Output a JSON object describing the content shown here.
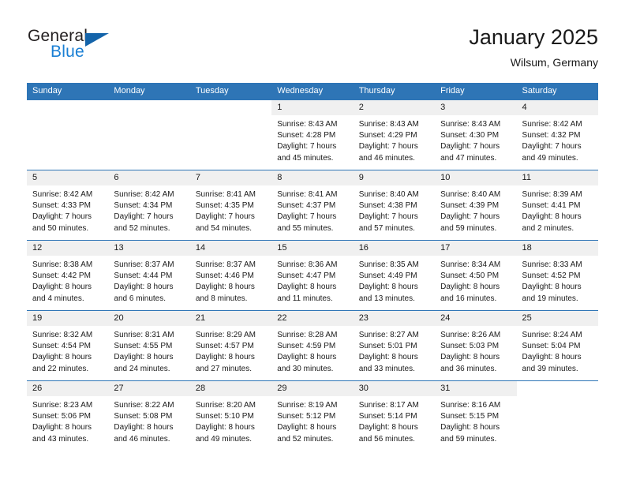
{
  "brand": {
    "name_part1": "General",
    "name_part2": "Blue",
    "triangle_color": "#1464aa",
    "blue_color": "#1a7fd4",
    "dark_color": "#231f20"
  },
  "header": {
    "title": "January 2025",
    "subtitle": "Wilsum, Germany"
  },
  "theme": {
    "header_bg": "#2e75b6",
    "daynum_bg": "#f0f0f0",
    "rule_color": "#2e75b6"
  },
  "weekday_headers": [
    "Sunday",
    "Monday",
    "Tuesday",
    "Wednesday",
    "Thursday",
    "Friday",
    "Saturday"
  ],
  "weeks": [
    [
      {
        "day": "",
        "lines": []
      },
      {
        "day": "",
        "lines": []
      },
      {
        "day": "",
        "lines": []
      },
      {
        "day": "1",
        "lines": [
          "Sunrise: 8:43 AM",
          "Sunset: 4:28 PM",
          "Daylight: 7 hours",
          "and 45 minutes."
        ]
      },
      {
        "day": "2",
        "lines": [
          "Sunrise: 8:43 AM",
          "Sunset: 4:29 PM",
          "Daylight: 7 hours",
          "and 46 minutes."
        ]
      },
      {
        "day": "3",
        "lines": [
          "Sunrise: 8:43 AM",
          "Sunset: 4:30 PM",
          "Daylight: 7 hours",
          "and 47 minutes."
        ]
      },
      {
        "day": "4",
        "lines": [
          "Sunrise: 8:42 AM",
          "Sunset: 4:32 PM",
          "Daylight: 7 hours",
          "and 49 minutes."
        ]
      }
    ],
    [
      {
        "day": "5",
        "lines": [
          "Sunrise: 8:42 AM",
          "Sunset: 4:33 PM",
          "Daylight: 7 hours",
          "and 50 minutes."
        ]
      },
      {
        "day": "6",
        "lines": [
          "Sunrise: 8:42 AM",
          "Sunset: 4:34 PM",
          "Daylight: 7 hours",
          "and 52 minutes."
        ]
      },
      {
        "day": "7",
        "lines": [
          "Sunrise: 8:41 AM",
          "Sunset: 4:35 PM",
          "Daylight: 7 hours",
          "and 54 minutes."
        ]
      },
      {
        "day": "8",
        "lines": [
          "Sunrise: 8:41 AM",
          "Sunset: 4:37 PM",
          "Daylight: 7 hours",
          "and 55 minutes."
        ]
      },
      {
        "day": "9",
        "lines": [
          "Sunrise: 8:40 AM",
          "Sunset: 4:38 PM",
          "Daylight: 7 hours",
          "and 57 minutes."
        ]
      },
      {
        "day": "10",
        "lines": [
          "Sunrise: 8:40 AM",
          "Sunset: 4:39 PM",
          "Daylight: 7 hours",
          "and 59 minutes."
        ]
      },
      {
        "day": "11",
        "lines": [
          "Sunrise: 8:39 AM",
          "Sunset: 4:41 PM",
          "Daylight: 8 hours",
          "and 2 minutes."
        ]
      }
    ],
    [
      {
        "day": "12",
        "lines": [
          "Sunrise: 8:38 AM",
          "Sunset: 4:42 PM",
          "Daylight: 8 hours",
          "and 4 minutes."
        ]
      },
      {
        "day": "13",
        "lines": [
          "Sunrise: 8:37 AM",
          "Sunset: 4:44 PM",
          "Daylight: 8 hours",
          "and 6 minutes."
        ]
      },
      {
        "day": "14",
        "lines": [
          "Sunrise: 8:37 AM",
          "Sunset: 4:46 PM",
          "Daylight: 8 hours",
          "and 8 minutes."
        ]
      },
      {
        "day": "15",
        "lines": [
          "Sunrise: 8:36 AM",
          "Sunset: 4:47 PM",
          "Daylight: 8 hours",
          "and 11 minutes."
        ]
      },
      {
        "day": "16",
        "lines": [
          "Sunrise: 8:35 AM",
          "Sunset: 4:49 PM",
          "Daylight: 8 hours",
          "and 13 minutes."
        ]
      },
      {
        "day": "17",
        "lines": [
          "Sunrise: 8:34 AM",
          "Sunset: 4:50 PM",
          "Daylight: 8 hours",
          "and 16 minutes."
        ]
      },
      {
        "day": "18",
        "lines": [
          "Sunrise: 8:33 AM",
          "Sunset: 4:52 PM",
          "Daylight: 8 hours",
          "and 19 minutes."
        ]
      }
    ],
    [
      {
        "day": "19",
        "lines": [
          "Sunrise: 8:32 AM",
          "Sunset: 4:54 PM",
          "Daylight: 8 hours",
          "and 22 minutes."
        ]
      },
      {
        "day": "20",
        "lines": [
          "Sunrise: 8:31 AM",
          "Sunset: 4:55 PM",
          "Daylight: 8 hours",
          "and 24 minutes."
        ]
      },
      {
        "day": "21",
        "lines": [
          "Sunrise: 8:29 AM",
          "Sunset: 4:57 PM",
          "Daylight: 8 hours",
          "and 27 minutes."
        ]
      },
      {
        "day": "22",
        "lines": [
          "Sunrise: 8:28 AM",
          "Sunset: 4:59 PM",
          "Daylight: 8 hours",
          "and 30 minutes."
        ]
      },
      {
        "day": "23",
        "lines": [
          "Sunrise: 8:27 AM",
          "Sunset: 5:01 PM",
          "Daylight: 8 hours",
          "and 33 minutes."
        ]
      },
      {
        "day": "24",
        "lines": [
          "Sunrise: 8:26 AM",
          "Sunset: 5:03 PM",
          "Daylight: 8 hours",
          "and 36 minutes."
        ]
      },
      {
        "day": "25",
        "lines": [
          "Sunrise: 8:24 AM",
          "Sunset: 5:04 PM",
          "Daylight: 8 hours",
          "and 39 minutes."
        ]
      }
    ],
    [
      {
        "day": "26",
        "lines": [
          "Sunrise: 8:23 AM",
          "Sunset: 5:06 PM",
          "Daylight: 8 hours",
          "and 43 minutes."
        ]
      },
      {
        "day": "27",
        "lines": [
          "Sunrise: 8:22 AM",
          "Sunset: 5:08 PM",
          "Daylight: 8 hours",
          "and 46 minutes."
        ]
      },
      {
        "day": "28",
        "lines": [
          "Sunrise: 8:20 AM",
          "Sunset: 5:10 PM",
          "Daylight: 8 hours",
          "and 49 minutes."
        ]
      },
      {
        "day": "29",
        "lines": [
          "Sunrise: 8:19 AM",
          "Sunset: 5:12 PM",
          "Daylight: 8 hours",
          "and 52 minutes."
        ]
      },
      {
        "day": "30",
        "lines": [
          "Sunrise: 8:17 AM",
          "Sunset: 5:14 PM",
          "Daylight: 8 hours",
          "and 56 minutes."
        ]
      },
      {
        "day": "31",
        "lines": [
          "Sunrise: 8:16 AM",
          "Sunset: 5:15 PM",
          "Daylight: 8 hours",
          "and 59 minutes."
        ]
      },
      {
        "day": "",
        "lines": []
      }
    ]
  ]
}
